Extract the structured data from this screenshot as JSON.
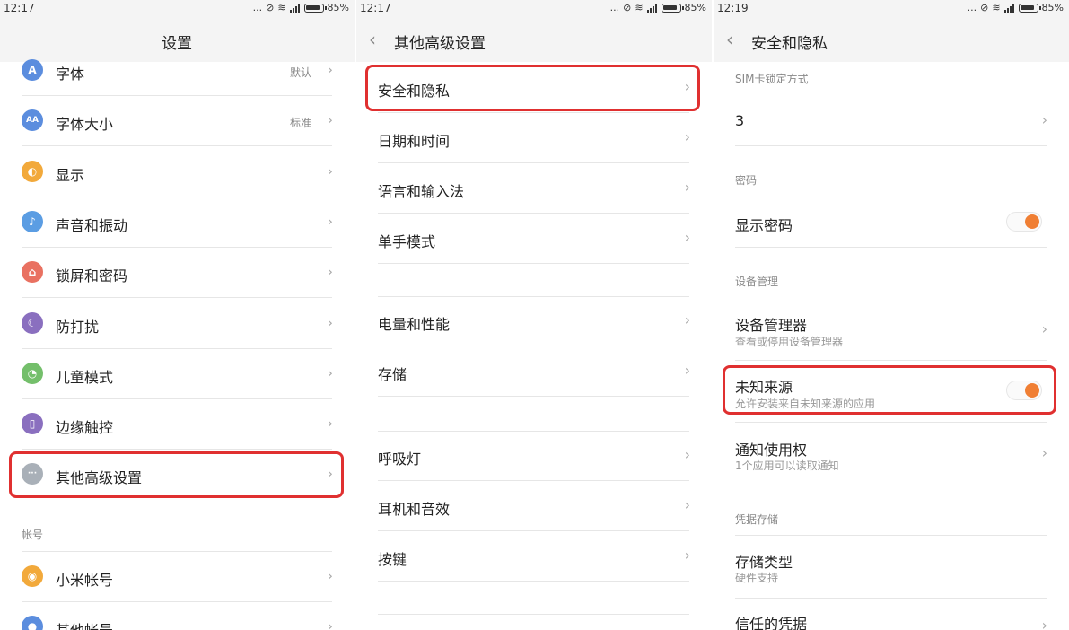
{
  "status": {
    "p1_time": "12:17",
    "p2_time": "12:17",
    "p3_time": "12:19",
    "dots": "...",
    "battery_text": "85%"
  },
  "panel1": {
    "title": "设置",
    "items": [
      {
        "label": "字体",
        "value": "默认",
        "icon": "font-icon",
        "glyph": "A",
        "color": "#5b8dde"
      },
      {
        "label": "字体大小",
        "value": "标准",
        "icon": "font-size-icon",
        "glyph": "AA",
        "color": "#5b8dde"
      },
      {
        "label": "显示",
        "value": "",
        "icon": "display-icon",
        "glyph": "◐",
        "color": "#f2a93b"
      },
      {
        "label": "声音和振动",
        "value": "",
        "icon": "sound-icon",
        "glyph": "♪",
        "color": "#5b9de3"
      },
      {
        "label": "锁屏和密码",
        "value": "",
        "icon": "lock-icon",
        "glyph": "⌂",
        "color": "#e97161"
      },
      {
        "label": "防打扰",
        "value": "",
        "icon": "moon-icon",
        "glyph": "☾",
        "color": "#8a6fbf"
      },
      {
        "label": "儿童模式",
        "value": "",
        "icon": "child-mode-icon",
        "glyph": "◔",
        "color": "#74bf6b"
      },
      {
        "label": "边缘触控",
        "value": "",
        "icon": "edge-touch-icon",
        "glyph": "▯",
        "color": "#8a6fbf"
      },
      {
        "label": "其他高级设置",
        "value": "",
        "icon": "more-icon",
        "glyph": "···",
        "color": "#a9b0b8"
      }
    ],
    "section_account": "帐号",
    "account_items": [
      {
        "label": "小米帐号",
        "icon": "mi-account-icon",
        "glyph": "◉",
        "color": "#f2a93b"
      },
      {
        "label": "其他帐号",
        "icon": "other-account-icon",
        "glyph": "●",
        "color": "#5b8dde"
      }
    ]
  },
  "panel2": {
    "title": "其他高级设置",
    "items": [
      "安全和隐私",
      "日期和时间",
      "语言和输入法",
      "单手模式",
      "电量和性能",
      "存储",
      "呼吸灯",
      "耳机和音效",
      "按键"
    ]
  },
  "panel3": {
    "title": "安全和隐私",
    "sim_section": "SIM卡锁定方式",
    "sim_value": "3",
    "password_section": "密码",
    "show_password": "显示密码",
    "device_section": "设备管理",
    "device_manager": "设备管理器",
    "device_manager_sub": "查看或停用设备管理器",
    "unknown_sources": "未知来源",
    "unknown_sources_sub": "允许安装来自未知来源的应用",
    "notification_access": "通知使用权",
    "notification_access_sub": "1个应用可以读取通知",
    "credential_section": "凭据存储",
    "storage_type": "存储类型",
    "storage_type_sub": "硬件支持",
    "trusted_credentials": "信任的凭据"
  },
  "colors": {
    "accent_orange": "#f07f34",
    "highlight_red": "#e03030"
  }
}
